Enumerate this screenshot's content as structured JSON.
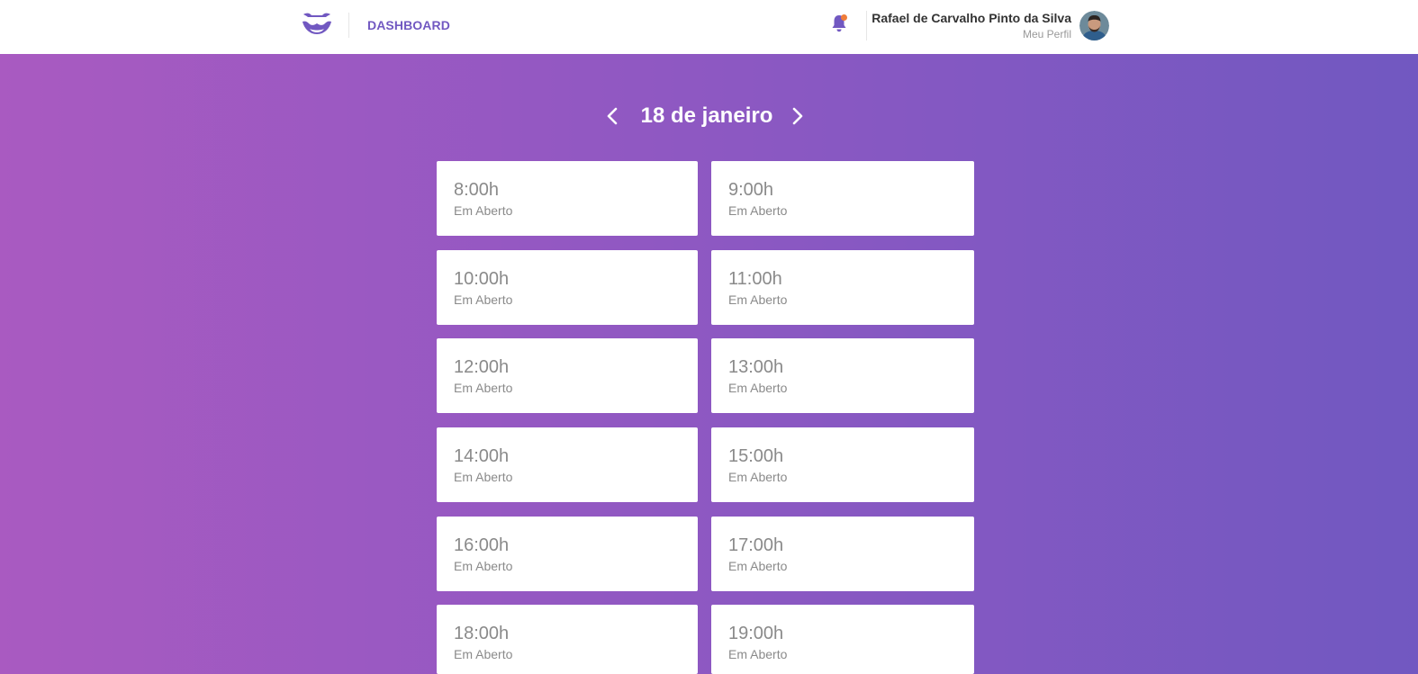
{
  "header": {
    "nav_label": "DASHBOARD",
    "user_name": "Rafael de Carvalho Pinto da Silva",
    "profile_link": "Meu Perfil",
    "notification_icon": "bell-icon",
    "has_notification": true,
    "brand_color": "#7158c1",
    "notification_color": "#f07d3a"
  },
  "schedule": {
    "date_label": "18 de janeiro",
    "prev_icon": "chevron-left-icon",
    "next_icon": "chevron-right-icon",
    "slots": [
      {
        "time": "8:00h",
        "status": "Em Aberto"
      },
      {
        "time": "9:00h",
        "status": "Em Aberto"
      },
      {
        "time": "10:00h",
        "status": "Em Aberto"
      },
      {
        "time": "11:00h",
        "status": "Em Aberto"
      },
      {
        "time": "12:00h",
        "status": "Em Aberto"
      },
      {
        "time": "13:00h",
        "status": "Em Aberto"
      },
      {
        "time": "14:00h",
        "status": "Em Aberto"
      },
      {
        "time": "15:00h",
        "status": "Em Aberto"
      },
      {
        "time": "16:00h",
        "status": "Em Aberto"
      },
      {
        "time": "17:00h",
        "status": "Em Aberto"
      },
      {
        "time": "18:00h",
        "status": "Em Aberto"
      },
      {
        "time": "19:00h",
        "status": "Em Aberto"
      }
    ]
  }
}
